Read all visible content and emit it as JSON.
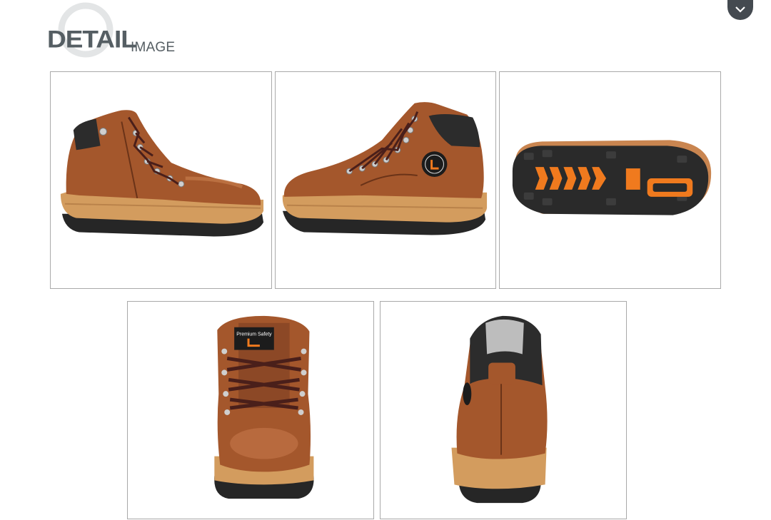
{
  "header": {
    "title_main": "DETAIL",
    "title_sub": "IMAGE"
  },
  "icons": {
    "header_decoration": "magnifier-ring-icon",
    "scroll_handle": "chevron-down-icon"
  },
  "colors": {
    "title": "#555e63",
    "frame_border": "#a9a9a9",
    "leather": "#a4572c",
    "midsole": "#d19a5c",
    "outsole": "#2a2a2a",
    "accent_orange": "#f07a1e"
  },
  "gallery": {
    "images": [
      {
        "view": "side-left"
      },
      {
        "view": "side-right"
      },
      {
        "view": "sole"
      },
      {
        "view": "front"
      },
      {
        "view": "back"
      }
    ],
    "badge_text": "Premium Safety"
  }
}
